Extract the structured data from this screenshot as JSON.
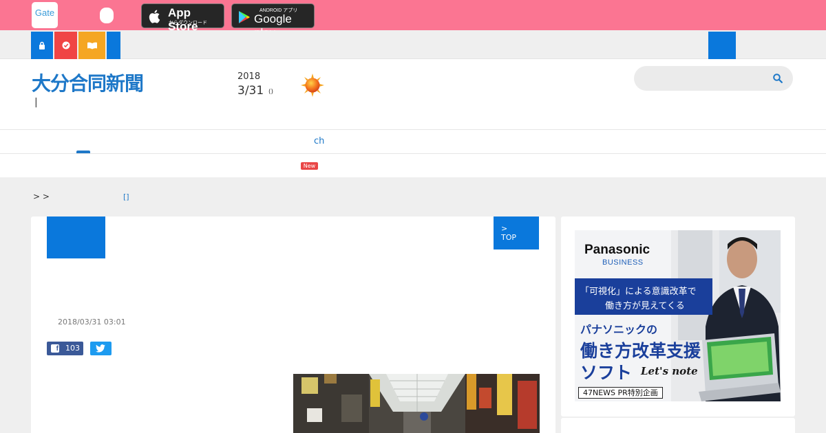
{
  "topbar": {
    "gate_logo_text": "Gate",
    "appstore": {
      "main": "App Store",
      "sub": "からダウンロード"
    },
    "googleplay": {
      "top": "ANDROID アプリ",
      "main": "Google play"
    }
  },
  "header": {
    "logo": "大分合同新聞",
    "cursor_text": "|",
    "year": "2018",
    "date": "3/31",
    "day_of_week": "()",
    "weather_icon": "sun-icon",
    "ch_link": "ch",
    "new_badge": "New"
  },
  "breadcrumb": {
    "text": "> >",
    "link": "[]"
  },
  "article": {
    "top_button": ">\nTOP",
    "timestamp": "2018/03/31 03:01",
    "facebook_count": "103"
  },
  "ad": {
    "brand": "Panasonic",
    "brand_sub": "BUSINESS",
    "headline_1": "「可視化」による意識改革で",
    "headline_2": "働き方が見えてくる",
    "sub_1": "パナソニックの",
    "sub_2": "働き方改革支援",
    "sub_3": "ソフト",
    "product": "Let's note",
    "pr_label": "47NEWS PR特別企画"
  },
  "colors": {
    "topbar": "#fb7592",
    "accent_blue": "#0a78dc",
    "red": "#f04545",
    "orange": "#f5a623"
  }
}
